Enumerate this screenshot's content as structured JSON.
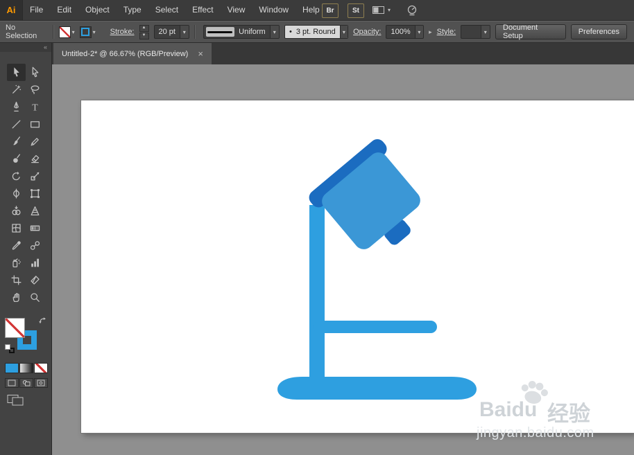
{
  "app": {
    "logo_text": "Ai"
  },
  "menu": {
    "items": [
      "File",
      "Edit",
      "Object",
      "Type",
      "Select",
      "Effect",
      "View",
      "Window",
      "Help"
    ]
  },
  "app_bar": {
    "bridge_label": "Br",
    "stock_label": "St"
  },
  "control_bar": {
    "selection_status": "No Selection",
    "stroke_label": "Stroke:",
    "stroke_weight": "20 pt",
    "width_profile": "Uniform",
    "brush_bullet": "•",
    "brush_name": "3 pt. Round",
    "opacity_label": "Opacity:",
    "opacity_value": "100%",
    "style_label": "Style:",
    "document_setup_label": "Document Setup",
    "preferences_label": "Preferences"
  },
  "tab": {
    "title": "Untitled-2* @ 66.67% (RGB/Preview)",
    "close_glyph": "×"
  },
  "toolbar": {
    "collapse_glyph": "«",
    "active_tool": "selection",
    "tools": [
      "selection",
      "direct-selection",
      "magic-wand",
      "lasso",
      "pen",
      "type",
      "line-segment",
      "rectangle",
      "paintbrush",
      "pencil",
      "blob-brush",
      "eraser",
      "rotate",
      "scale",
      "width",
      "free-transform",
      "shape-builder",
      "perspective-grid",
      "mesh",
      "gradient",
      "eyedropper",
      "blend",
      "symbol-sprayer",
      "column-graph",
      "artboard",
      "slice",
      "hand",
      "zoom"
    ]
  },
  "colors": {
    "lamp_blue": "#2E9FE0",
    "lamp_head_blue": "#3B97D6",
    "lamp_dark_blue": "#1B6CC0",
    "stroke_swatch_blue": "#2D9FE0",
    "none_red": "#D23535",
    "logo_orange": "#FF9A00"
  },
  "watermark": {
    "brand": "Baidu",
    "brand_suffix": "经验",
    "url": "jingyan.baidu.com"
  }
}
